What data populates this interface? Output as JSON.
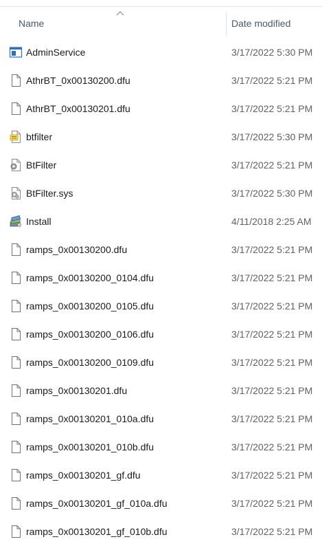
{
  "header": {
    "name_label": "Name",
    "date_label": "Date modified"
  },
  "files": [
    {
      "name": "AdminService",
      "date": "3/17/2022 5:30 PM",
      "icon": "application-window-icon"
    },
    {
      "name": "AthrBT_0x00130200.dfu",
      "date": "3/17/2022 5:21 PM",
      "icon": "file-icon"
    },
    {
      "name": "AthrBT_0x00130201.dfu",
      "date": "3/17/2022 5:21 PM",
      "icon": "file-icon"
    },
    {
      "name": "btfilter",
      "date": "3/17/2022 5:30 PM",
      "icon": "config-file-icon"
    },
    {
      "name": "BtFilter",
      "date": "3/17/2022 5:21 PM",
      "icon": "settings-file-icon"
    },
    {
      "name": "BtFilter.sys",
      "date": "3/17/2022 5:30 PM",
      "icon": "system-file-icon"
    },
    {
      "name": "Install",
      "date": "4/11/2018 2:25 AM",
      "icon": "installer-icon"
    },
    {
      "name": "ramps_0x00130200.dfu",
      "date": "3/17/2022 5:21 PM",
      "icon": "file-icon"
    },
    {
      "name": "ramps_0x00130200_0104.dfu",
      "date": "3/17/2022 5:21 PM",
      "icon": "file-icon"
    },
    {
      "name": "ramps_0x00130200_0105.dfu",
      "date": "3/17/2022 5:21 PM",
      "icon": "file-icon"
    },
    {
      "name": "ramps_0x00130200_0106.dfu",
      "date": "3/17/2022 5:21 PM",
      "icon": "file-icon"
    },
    {
      "name": "ramps_0x00130200_0109.dfu",
      "date": "3/17/2022 5:21 PM",
      "icon": "file-icon"
    },
    {
      "name": "ramps_0x00130201.dfu",
      "date": "3/17/2022 5:21 PM",
      "icon": "file-icon"
    },
    {
      "name": "ramps_0x00130201_010a.dfu",
      "date": "3/17/2022 5:21 PM",
      "icon": "file-icon"
    },
    {
      "name": "ramps_0x00130201_010b.dfu",
      "date": "3/17/2022 5:21 PM",
      "icon": "file-icon"
    },
    {
      "name": "ramps_0x00130201_gf.dfu",
      "date": "3/17/2022 5:21 PM",
      "icon": "file-icon"
    },
    {
      "name": "ramps_0x00130201_gf_010a.dfu",
      "date": "3/17/2022 5:21 PM",
      "icon": "file-icon"
    },
    {
      "name": "ramps_0x00130201_gf_010b.dfu",
      "date": "3/17/2022 5:21 PM",
      "icon": "file-icon"
    }
  ]
}
